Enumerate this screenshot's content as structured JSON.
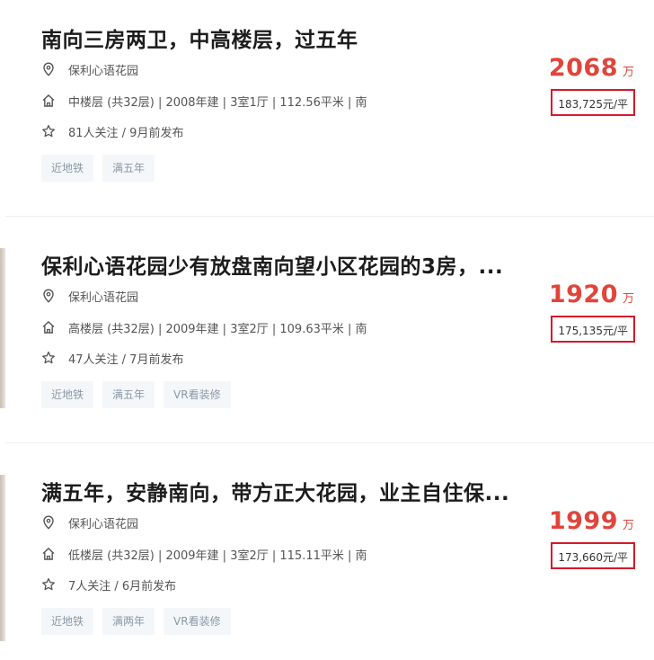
{
  "listings": [
    {
      "title": "南向三房两卫，中高楼层，过五年",
      "community": "保利心语花园",
      "info": "中楼层 (共32层) | 2008年建 | 3室1厅 | 112.56平米 | 南",
      "follow": "81人关注 / 9月前发布",
      "tags": [
        "近地铁",
        "满五年"
      ],
      "price": "2068",
      "price_unit": "万",
      "unit_price": "183,725元/平"
    },
    {
      "title": "保利心语花园少有放盘南向望小区花园的3房，...",
      "community": "保利心语花园",
      "info": "高楼层 (共32层) | 2009年建 | 3室2厅 | 109.63平米 | 南",
      "follow": "47人关注 / 7月前发布",
      "tags": [
        "近地铁",
        "满五年",
        "VR看装修"
      ],
      "price": "1920",
      "price_unit": "万",
      "unit_price": "175,135元/平"
    },
    {
      "title": "满五年，安静南向，带方正大花园，业主自住保...",
      "community": "保利心语花园",
      "info": "低楼层 (共32层) | 2009年建 | 3室2厅 | 115.11平米 | 南",
      "follow": "7人关注 / 6月前发布",
      "tags": [
        "近地铁",
        "满两年",
        "VR看装修"
      ],
      "price": "1999",
      "price_unit": "万",
      "unit_price": "173,660元/平"
    }
  ],
  "icons": {
    "community": "location-pin-icon",
    "info": "house-icon",
    "follow": "star-icon"
  },
  "colors": {
    "price": "#e0453c",
    "unit_price_border": "#d6192b",
    "tag_bg": "#f4f7f9",
    "tag_text": "#8a98a6"
  }
}
